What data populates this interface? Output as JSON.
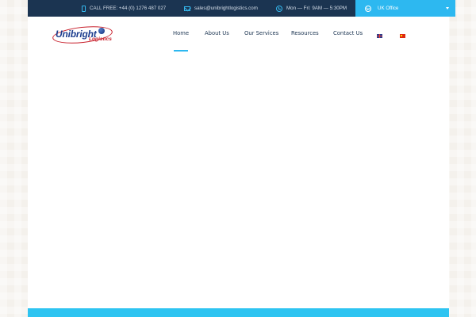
{
  "topbar": {
    "phone": {
      "icon": "phone-icon",
      "text": "CALL FREE: +44 (0) 1276 487 027"
    },
    "email": {
      "icon": "mail-icon",
      "text": "sales@unibrightlogistics.com"
    },
    "hours": {
      "icon": "clock-icon",
      "text": "Mon — Fri: 9AM — 5:30PM"
    },
    "office": {
      "icon": "globe-icon",
      "selected": "UK Office",
      "caret_icon": "caret-down-icon"
    }
  },
  "logo": {
    "word": "Unibright",
    "sub": "Logistics"
  },
  "nav": {
    "items": [
      "Home",
      "About Us",
      "Our Services",
      "Resources",
      "Contact Us"
    ],
    "active": "Home",
    "languages": [
      "uk-flag-icon",
      "china-flag-icon"
    ]
  },
  "colors": {
    "topbar_bg": "#1b3451",
    "accent": "#2db8f0",
    "footer_strip": "#2ec4f1",
    "logo_blue": "#1c3d8e",
    "logo_red": "#c8202c"
  }
}
